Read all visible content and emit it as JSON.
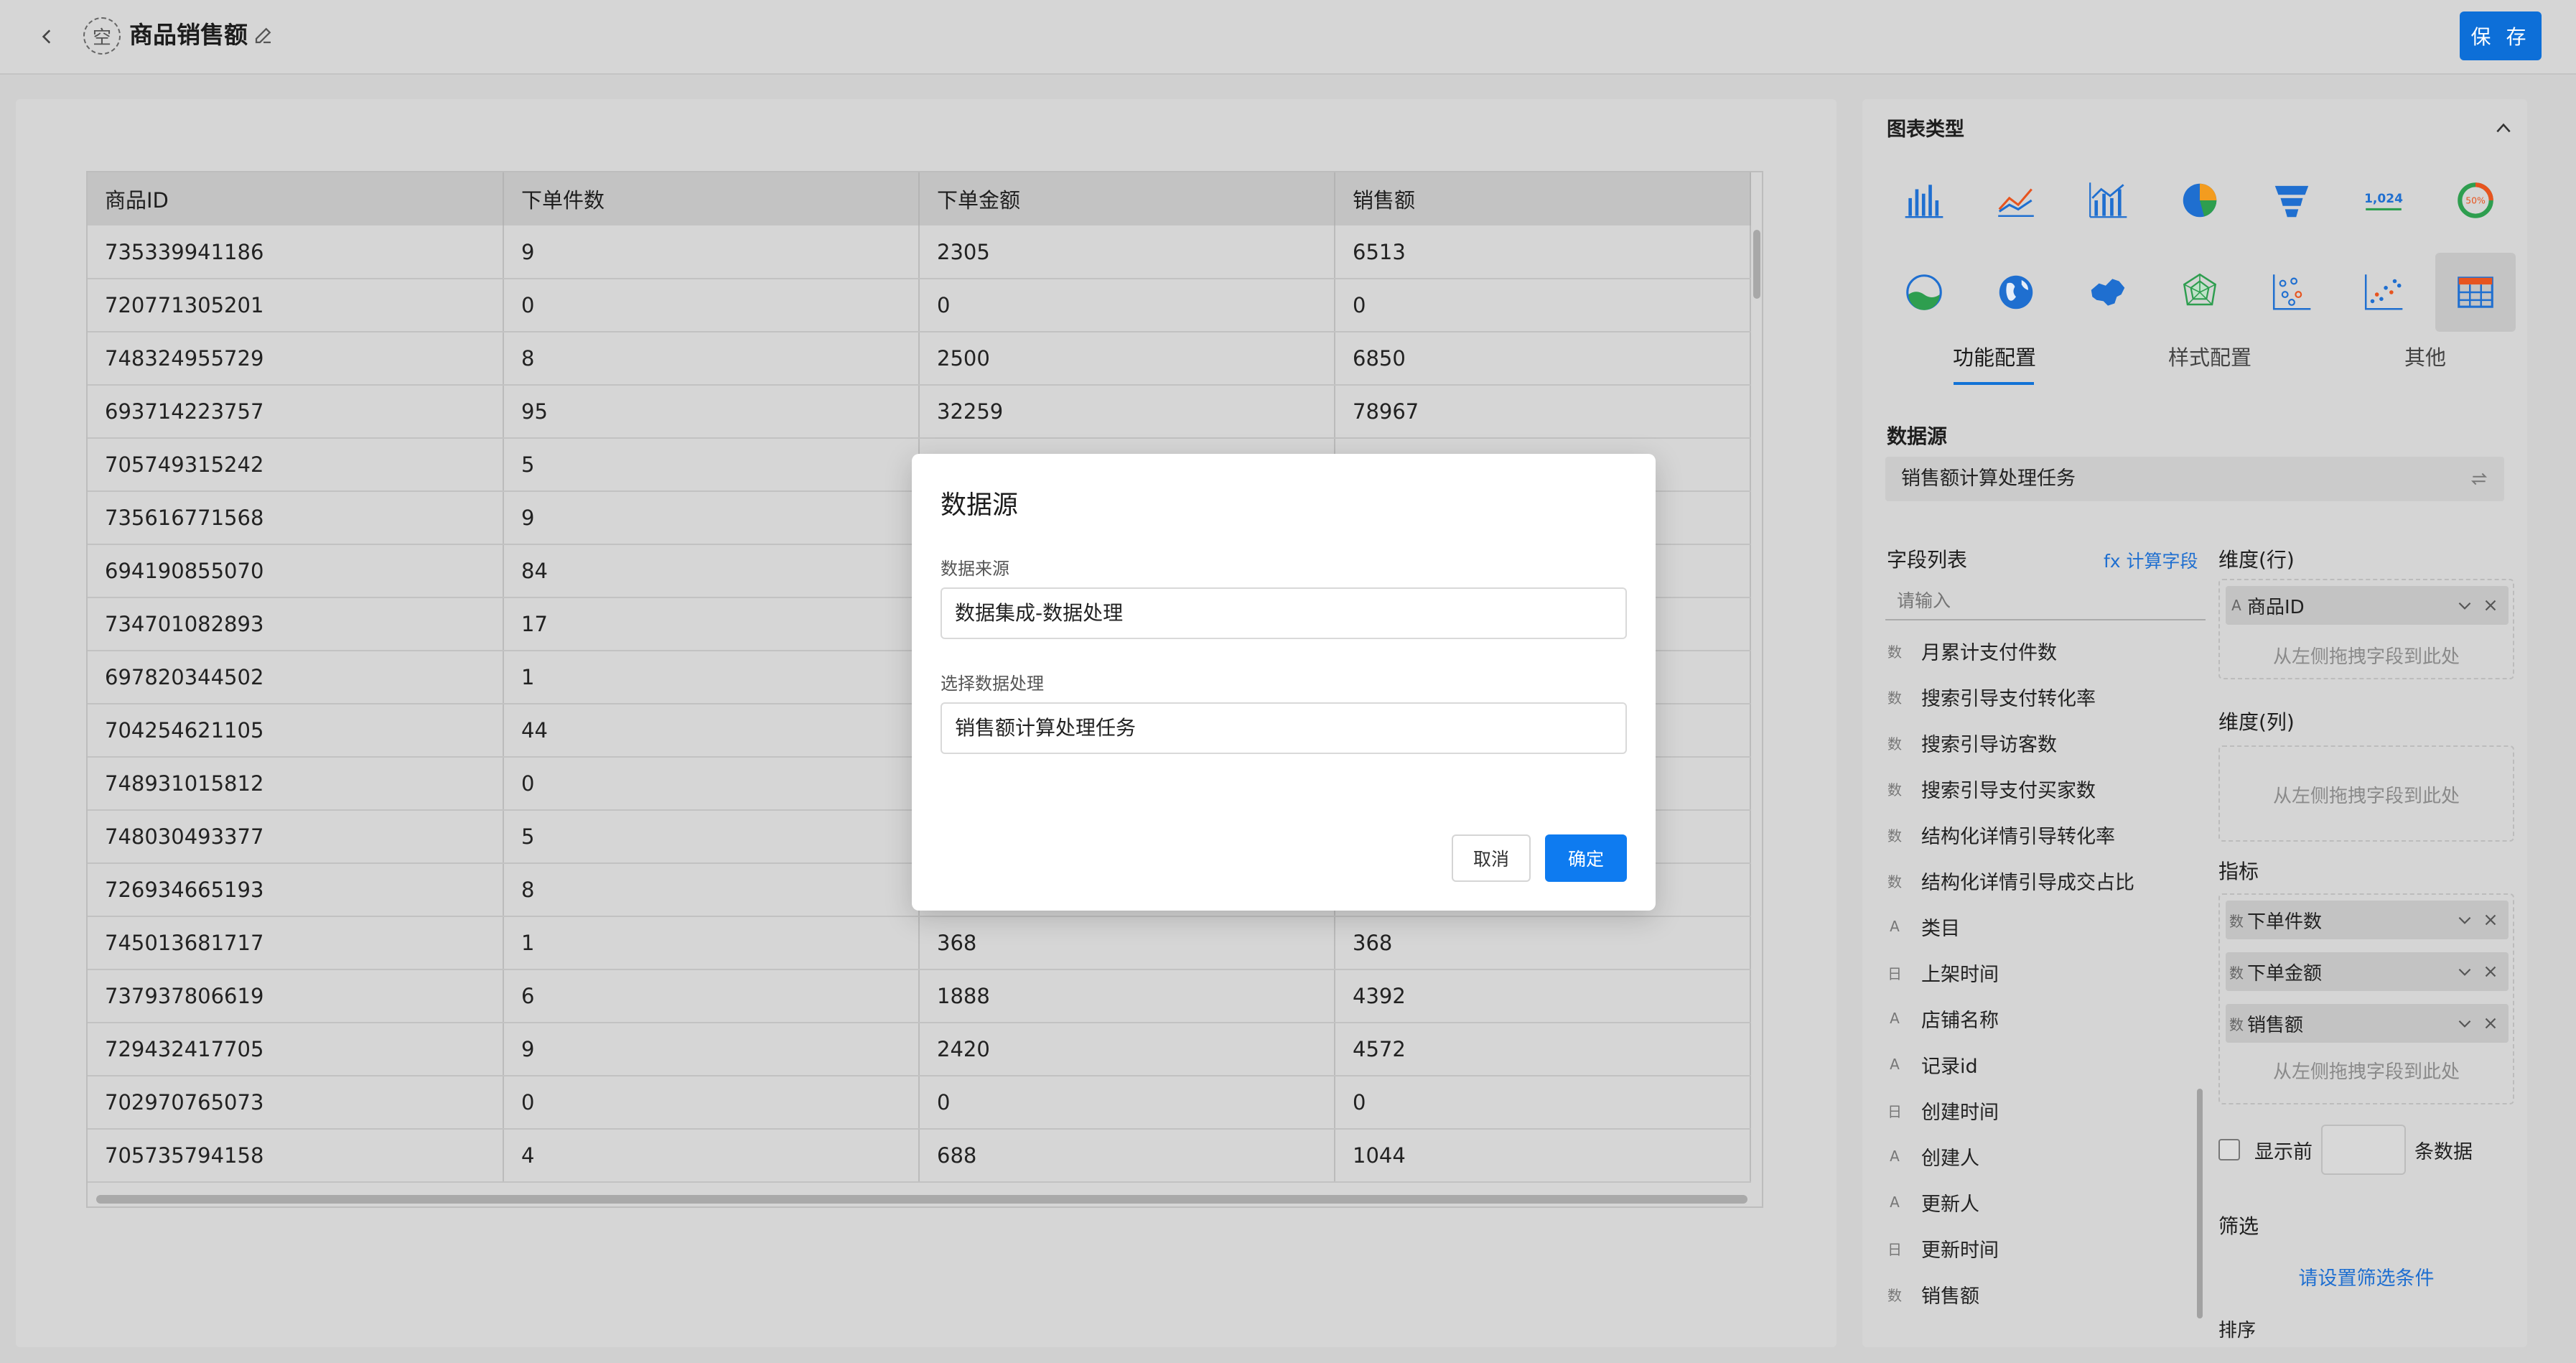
{
  "header": {
    "title": "商品销售额",
    "app_icon_text": "空",
    "save_label": "保 存"
  },
  "table": {
    "columns": [
      "商品ID",
      "下单件数",
      "下单金额",
      "销售额"
    ],
    "rows": [
      [
        "735339941186",
        "9",
        "2305",
        "6513"
      ],
      [
        "720771305201",
        "0",
        "0",
        "0"
      ],
      [
        "748324955729",
        "8",
        "2500",
        "6850"
      ],
      [
        "693714223757",
        "95",
        "32259",
        "78967"
      ],
      [
        "705749315242",
        "5",
        "",
        ""
      ],
      [
        "735616771568",
        "9",
        "",
        ""
      ],
      [
        "694190855070",
        "84",
        "",
        ""
      ],
      [
        "734701082893",
        "17",
        "",
        ""
      ],
      [
        "697820344502",
        "1",
        "",
        ""
      ],
      [
        "704254621105",
        "44",
        "",
        ""
      ],
      [
        "748931015812",
        "0",
        "",
        ""
      ],
      [
        "748030493377",
        "5",
        "",
        ""
      ],
      [
        "726934665193",
        "8",
        "",
        ""
      ],
      [
        "745013681717",
        "1",
        "368",
        "368"
      ],
      [
        "737937806619",
        "6",
        "1888",
        "4392"
      ],
      [
        "729432417705",
        "9",
        "2420",
        "4572"
      ],
      [
        "702970765073",
        "0",
        "0",
        "0"
      ],
      [
        "705735794158",
        "4",
        "688",
        "1044"
      ]
    ]
  },
  "sidebar": {
    "chart_type_title": "图表类型",
    "chart_types": [
      "bar-chart-icon",
      "line-chart-icon",
      "combo-chart-icon",
      "pie-chart-icon",
      "funnel-chart-icon",
      "number-card-icon",
      "percent-ring-icon",
      "water-ball-icon",
      "globe-map-icon",
      "china-map-icon",
      "radar-chart-icon",
      "bubble-chart-icon",
      "scatter-chart-icon",
      "table-chart-icon"
    ],
    "number_card_text": "1,024",
    "percent_ring_text": "50%",
    "tabs": [
      "功能配置",
      "样式配置",
      "其他"
    ],
    "datasource_label": "数据源",
    "datasource_value": "销售额计算处理任务",
    "field_list_label": "字段列表",
    "calc_field_label": "fx 计算字段",
    "field_search_placeholder": "请输入",
    "fields": [
      {
        "type": "数",
        "name": "月累计支付件数"
      },
      {
        "type": "数",
        "name": "搜索引导支付转化率"
      },
      {
        "type": "数",
        "name": "搜索引导访客数"
      },
      {
        "type": "数",
        "name": "搜索引导支付买家数"
      },
      {
        "type": "数",
        "name": "结构化详情引导转化率"
      },
      {
        "type": "数",
        "name": "结构化详情引导成交占比"
      },
      {
        "type": "A",
        "name": "类目"
      },
      {
        "type": "日",
        "name": "上架时间"
      },
      {
        "type": "A",
        "name": "店铺名称"
      },
      {
        "type": "A",
        "name": "记录id"
      },
      {
        "type": "日",
        "name": "创建时间"
      },
      {
        "type": "A",
        "name": "创建人"
      },
      {
        "type": "A",
        "name": "更新人"
      },
      {
        "type": "日",
        "name": "更新时间"
      },
      {
        "type": "数",
        "name": "销售额"
      }
    ],
    "dim_row_label": "维度(行)",
    "dim_row_chip": "商品ID",
    "dim_col_label": "维度(列)",
    "drop_hint": "从左侧拖拽字段到此处",
    "metrics_label": "指标",
    "metrics": [
      "下单件数",
      "下单金额",
      "销售额"
    ],
    "show_top_prefix": "显示前",
    "show_top_suffix": "条数据",
    "filter_label": "筛选",
    "filter_link": "请设置筛选条件",
    "sort_label_partial": "排序"
  },
  "modal": {
    "title": "数据源",
    "source_label": "数据来源",
    "source_value": "数据集成-数据处理",
    "process_label": "选择数据处理",
    "process_value": "销售额计算处理任务",
    "cancel_label": "取消",
    "ok_label": "确定"
  }
}
